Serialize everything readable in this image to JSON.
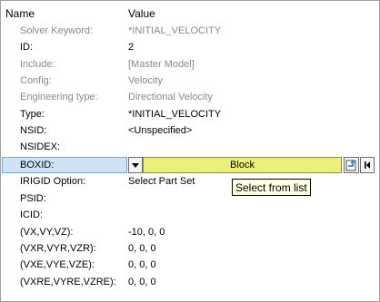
{
  "header": {
    "name_label": "Name",
    "value_label": "Value"
  },
  "rows": [
    {
      "name": "Solver Keyword:",
      "value": "*INITIAL_VELOCITY"
    },
    {
      "name": "ID:",
      "value": "2"
    },
    {
      "name": "Include:",
      "value": "[Master Model]"
    },
    {
      "name": "Config:",
      "value": "Velocity"
    },
    {
      "name": "Engineering type:",
      "value": "Directional Velocity"
    },
    {
      "name": "Type:",
      "value": "*INITIAL_VELOCITY"
    },
    {
      "name": "NSID:",
      "value": "<Unspecified>"
    },
    {
      "name": "NSIDEX:",
      "value": ""
    },
    {
      "name": "BOXID:",
      "value": "Block"
    },
    {
      "name": "IRIGID Option:",
      "value": "Select Part Set"
    },
    {
      "name": "PSID:",
      "value": ""
    },
    {
      "name": "ICID:",
      "value": ""
    },
    {
      "name": "(VX,VY,VZ):",
      "value": "-10, 0, 0"
    },
    {
      "name": "(VXR,VYR,VZR):",
      "value": "0, 0, 0"
    },
    {
      "name": "(VXE,VYE,VZE):",
      "value": "0, 0, 0"
    },
    {
      "name": "(VXRE,VYRE,VZRE):",
      "value": "0, 0, 0"
    }
  ],
  "tooltip": {
    "text": "Select from list"
  },
  "icons": {
    "dropdown": "chevron-down-icon",
    "select_entity": "select-entity-icon",
    "end": "skip-to-end-icon"
  },
  "colors": {
    "selected_row": "#cfe3f5",
    "field_highlight": "#ecf07a",
    "disabled_text": "#8a8a8a",
    "tooltip_bg": "#ffffe1"
  }
}
